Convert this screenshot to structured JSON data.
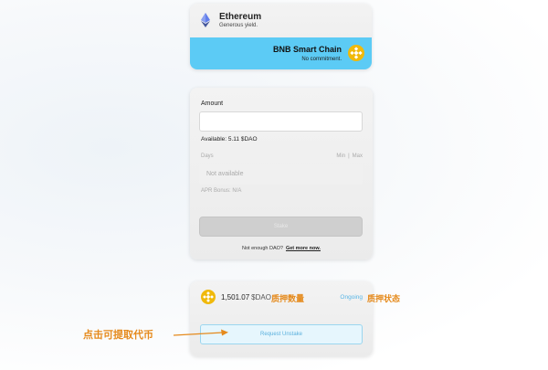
{
  "networks": {
    "ethereum": {
      "name": "Ethereum",
      "description": "Generous yield.",
      "icon": "ethereum-icon"
    },
    "bnb": {
      "name": "BNB Smart Chain",
      "description": "No commitment.",
      "icon": "bnb-icon",
      "selected": true,
      "highlight_color": "#5ccbf5"
    }
  },
  "stake_form": {
    "amount_label": "Amount",
    "amount_value": "",
    "available": "Available: 5.11 $DAO",
    "days_label": "Days",
    "min_label": "Min",
    "max_label": "Max",
    "days_placeholder": "Not available",
    "apr_bonus": "APR Bonus: N/A",
    "stake_button": "Stake",
    "not_enough": "Not enough DAO?",
    "get_more": "Get more now."
  },
  "position": {
    "amount": "1,501.07",
    "unit": "$DAO",
    "status": "Ongoing",
    "unstake_button": "Request Unstake",
    "icon": "bnb-icon"
  },
  "annotations": {
    "stake_quantity": "质押数量",
    "stake_status": "质押状态",
    "withdraw_tokens": "点击可提取代币",
    "color": "#e58a1c"
  }
}
